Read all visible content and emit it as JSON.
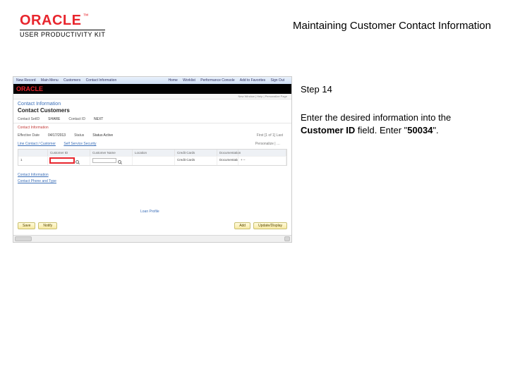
{
  "brand": {
    "name": "ORACLE",
    "tm": "™",
    "subtitle": "USER PRODUCTIVITY KIT"
  },
  "doc": {
    "title": "Maintaining Customer Contact Information"
  },
  "instruction": {
    "step_label": "Step 14",
    "line1": "Enter the desired information into the ",
    "field_bold": "Customer ID",
    "line2": " field. Enter \"",
    "value_bold": "50034",
    "line3": "\"."
  },
  "shot": {
    "toolbar": {
      "left": [
        "New Record",
        "Main Menu",
        "Customers",
        "Contact Information"
      ],
      "right": [
        "Home",
        "Worklist",
        "Performance Console",
        "Add to Favorites",
        "Sign Out"
      ]
    },
    "subbar": "New Window | Help | Personalize Page",
    "section_title": "Contact Information",
    "heading": "Contact Customers",
    "row1": {
      "k1": "Contact SetID",
      "v1": "SHARE",
      "k2": "Contact ID",
      "v2": "NEXT"
    },
    "red_section": "Contact Information",
    "row2": {
      "k1": "Effective Date",
      "v1": "04/17/2013",
      "k2": "Status",
      "v2": "Status Active"
    },
    "row2_right": "First [1 of 1] Last",
    "link_row": {
      "a": "Line Contact / Customer",
      "b": "Self Service Security"
    },
    "personalize": "Personalize | …",
    "thead": [
      "",
      "Customer ID",
      "Customer Name",
      "Location",
      "Credit Cards",
      "Documentation",
      "",
      ""
    ],
    "trow": {
      "seq": "1",
      "cust_id": "",
      "name": "",
      "loc": "",
      "cc": "Credit Cards",
      "doc": "Documentation",
      "a": "+",
      "b": "–"
    },
    "bottom_links": [
      "Contact Information",
      "Contact Phone and Type"
    ],
    "loan_profile": "Loan Profile",
    "footer": {
      "left": [
        "Save",
        "Notify"
      ],
      "right": [
        "Add",
        "Update/Display"
      ]
    }
  }
}
